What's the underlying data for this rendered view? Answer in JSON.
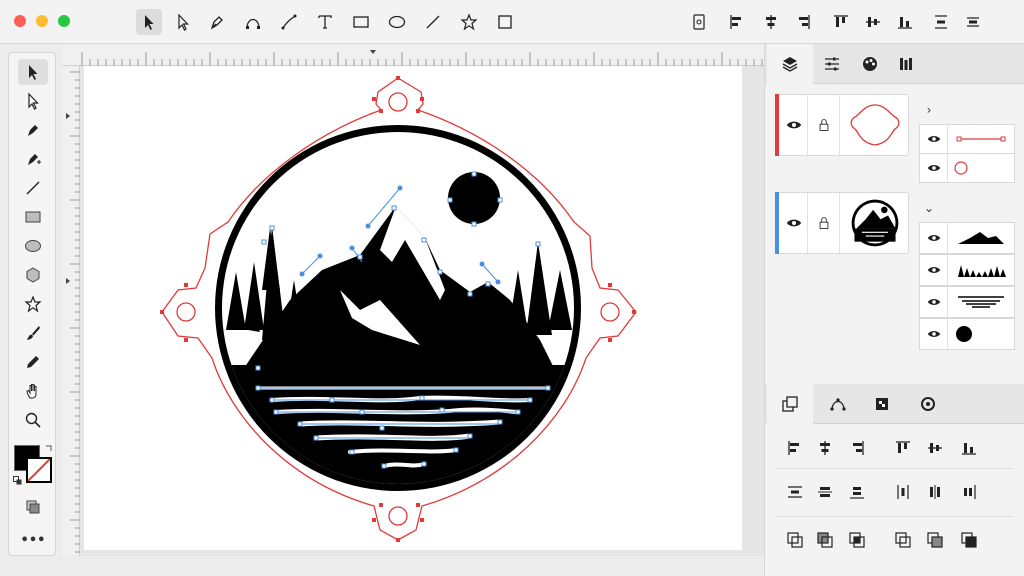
{
  "window": {
    "title": ""
  },
  "colors": {
    "selection_red": "#e03a3a",
    "path_blue": "#4a90e2",
    "layer_red": "#e03a3a",
    "layer_blue": "#4a90e2",
    "fill_black": "#000000"
  },
  "toolbar": {
    "tools": [
      "select-icon",
      "direct-select-icon",
      "pen-icon",
      "curvature-icon",
      "pencil-curve-icon",
      "text-icon",
      "rectangle-icon",
      "ellipse-icon",
      "line-icon",
      "star-icon",
      "crop-icon"
    ],
    "align": [
      "artboard-icon",
      "align-left-icon",
      "align-hcenter-icon",
      "align-right-icon",
      "align-top-icon",
      "align-vcenter-icon",
      "align-bottom-icon",
      "distribute-v-icon",
      "distribute-h-icon"
    ]
  },
  "toolbox": {
    "tools": [
      "select-icon",
      "direct-select-icon",
      "pen-icon",
      "pen-add-icon",
      "line-icon",
      "rectangle-icon",
      "ellipse-icon",
      "polygon-icon",
      "star-icon",
      "brush-icon",
      "pencil-icon",
      "hand-icon",
      "zoom-icon"
    ],
    "more_label": "•••"
  },
  "panel": {
    "top_tabs": [
      "layers-icon",
      "adjust-icon",
      "appearance-icon",
      "library-icon"
    ],
    "layers": [
      {
        "name": "frame",
        "color": "#e03a3a",
        "expanded_icon": "›",
        "children": [
          "line-path",
          "circle-path"
        ]
      },
      {
        "name": "emblem",
        "color": "#4a90e2",
        "expanded_icon": "⌄",
        "children": [
          "mountains",
          "trees",
          "water",
          "moon"
        ]
      }
    ],
    "bottom_tabs": [
      "transform-icon",
      "path-icon",
      "pathfinder-icon",
      "settings-icon"
    ]
  }
}
